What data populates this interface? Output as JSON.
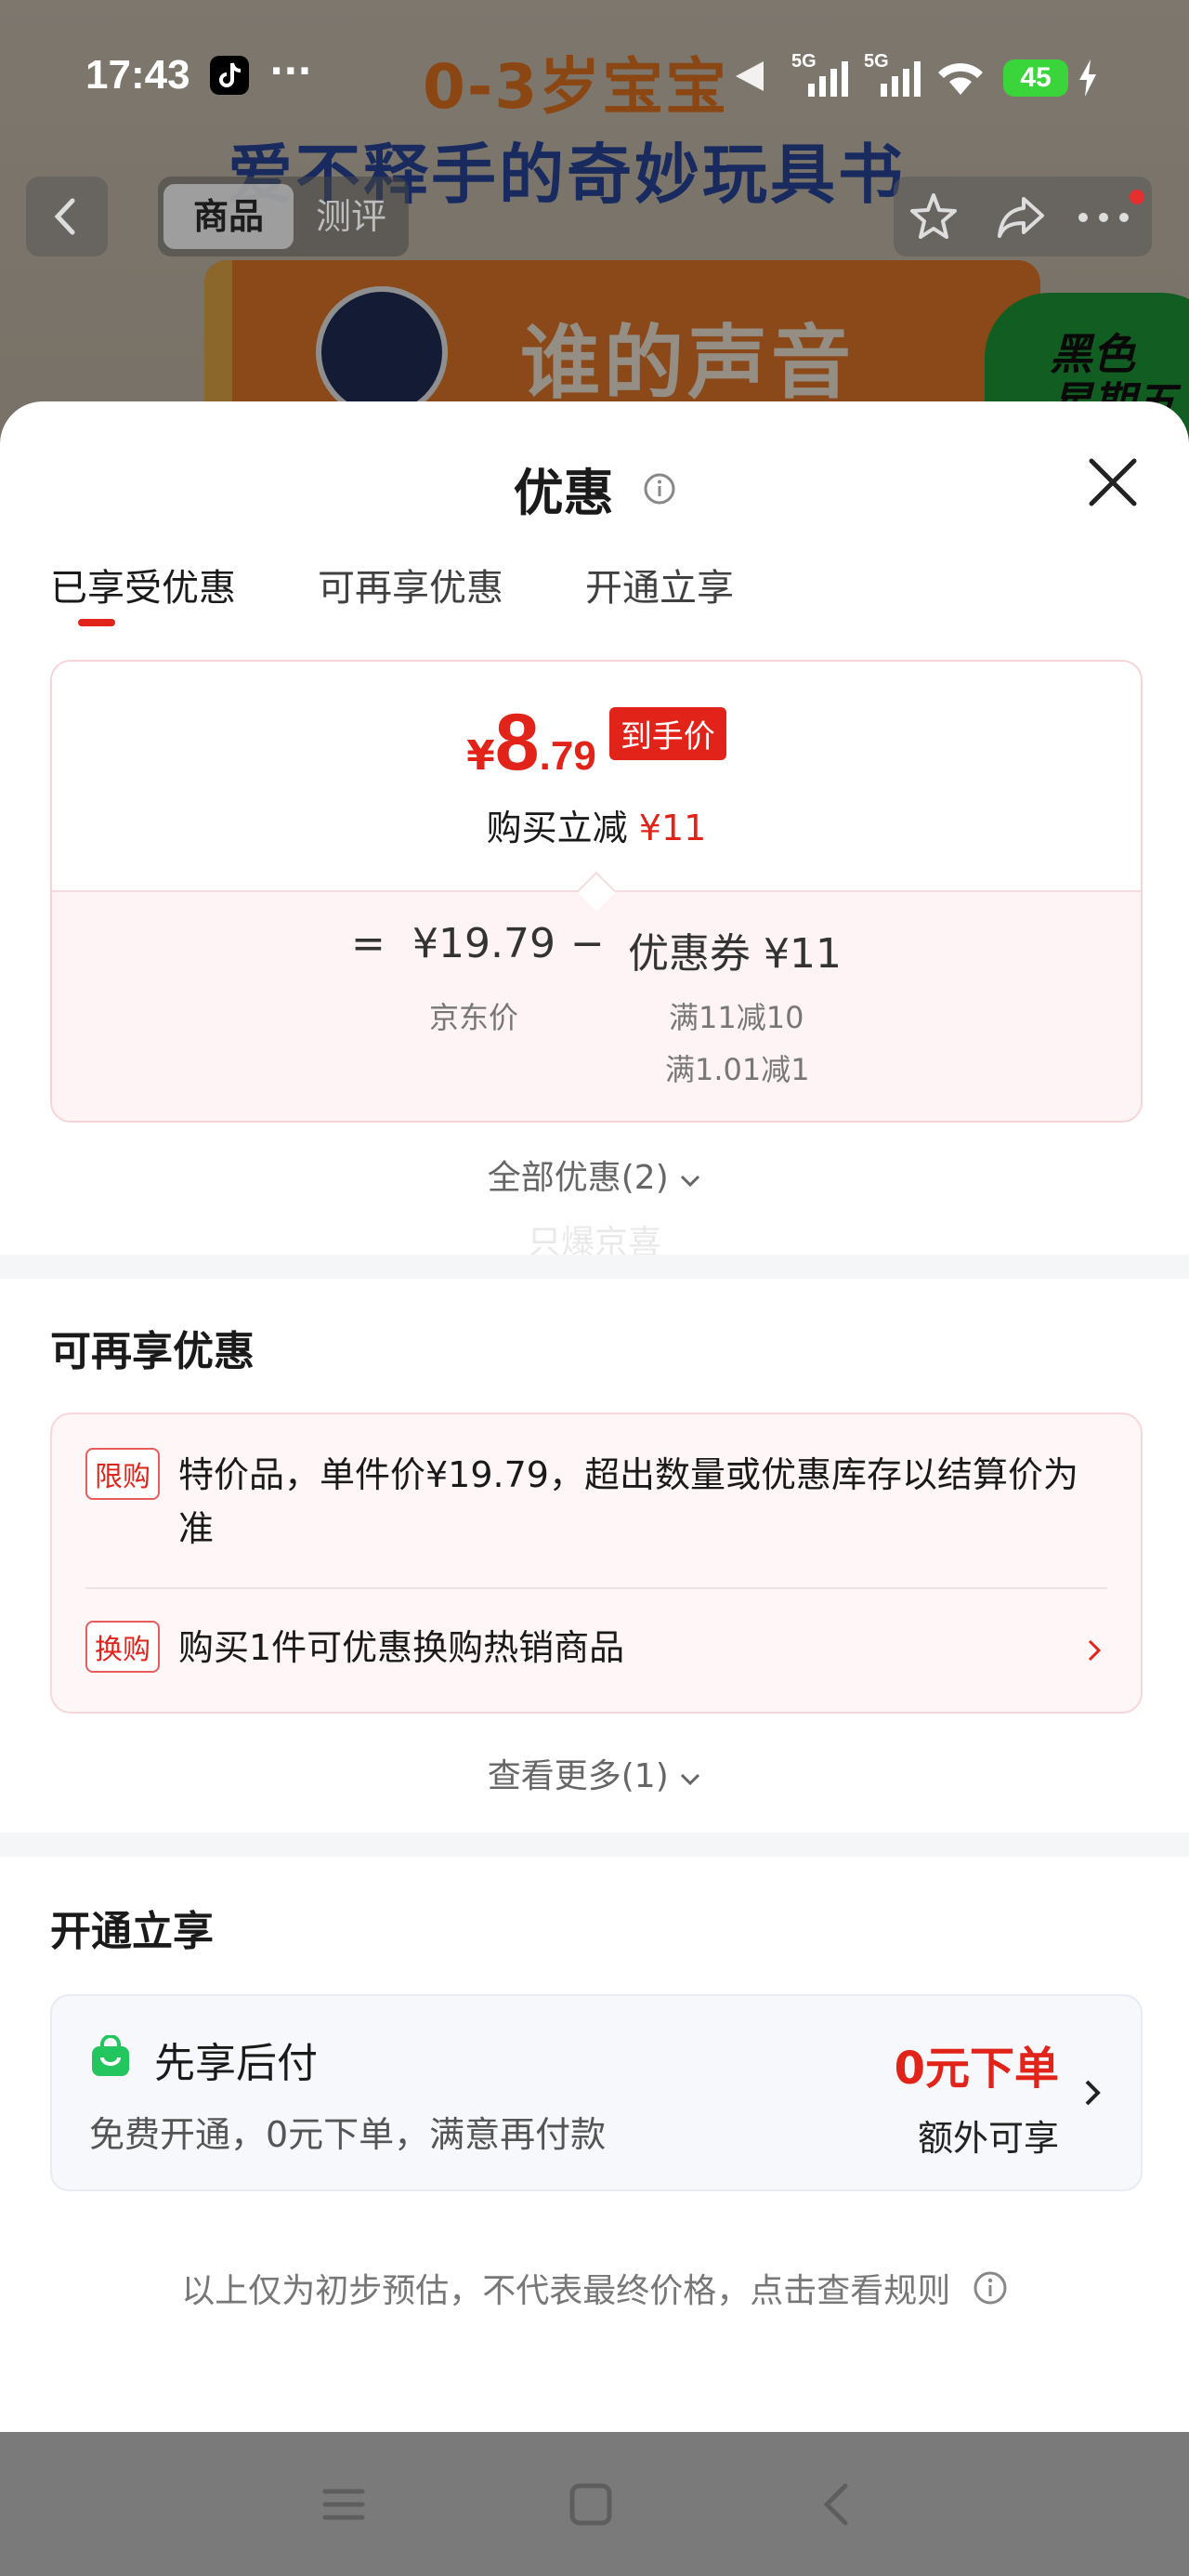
{
  "status_bar": {
    "time": "17:43",
    "dots": "···",
    "battery": "45"
  },
  "background_product": {
    "headline1": "0-3岁宝宝",
    "headline2": "爱不释手的奇妙玩具书",
    "book_title": "谁的声音",
    "badge_text": "黑色\n星期五",
    "nav_tab_active": "商品",
    "nav_tab_other": "测评"
  },
  "sheet": {
    "title": "优惠",
    "tabs": [
      "已享受优惠",
      "可再享优惠",
      "开通立享"
    ],
    "price": {
      "yen": "¥",
      "integer": "8",
      "decimal": ".79",
      "tag": "到手价",
      "sub_label": "购买立减",
      "sub_value": "¥11"
    },
    "breakdown": {
      "equals": "=",
      "jd_price": "¥19.79",
      "jd_label": "京东价",
      "minus": "−",
      "coupon": "优惠券 ¥11",
      "coupon_rule1": "满11减10",
      "coupon_rule2": "满1.01减1"
    },
    "all_discounts": "全部优惠(2)",
    "watermark": "只爆京喜",
    "more_title": "可再享优惠",
    "limit_badge": "限购",
    "limit_text": "特价品，单件价¥19.79，超出数量或优惠库存以结算价为准",
    "exchange_badge": "换购",
    "exchange_text": "购买1件可优惠换购热销商品",
    "see_more": "查看更多(1)",
    "open_title": "开通立享",
    "pay_after_title": "先享后付",
    "pay_after_desc": "免费开通，0元下单，满意再付款",
    "pay_after_zero": "0元下单",
    "pay_after_extra": "额外可享",
    "disclaimer": "以上仅为初步预估，不代表最终价格，点击查看规则"
  },
  "colors": {
    "accent_red": "#e2231a",
    "card_pink": "#fff4f5",
    "pay_green": "#22c55e"
  }
}
